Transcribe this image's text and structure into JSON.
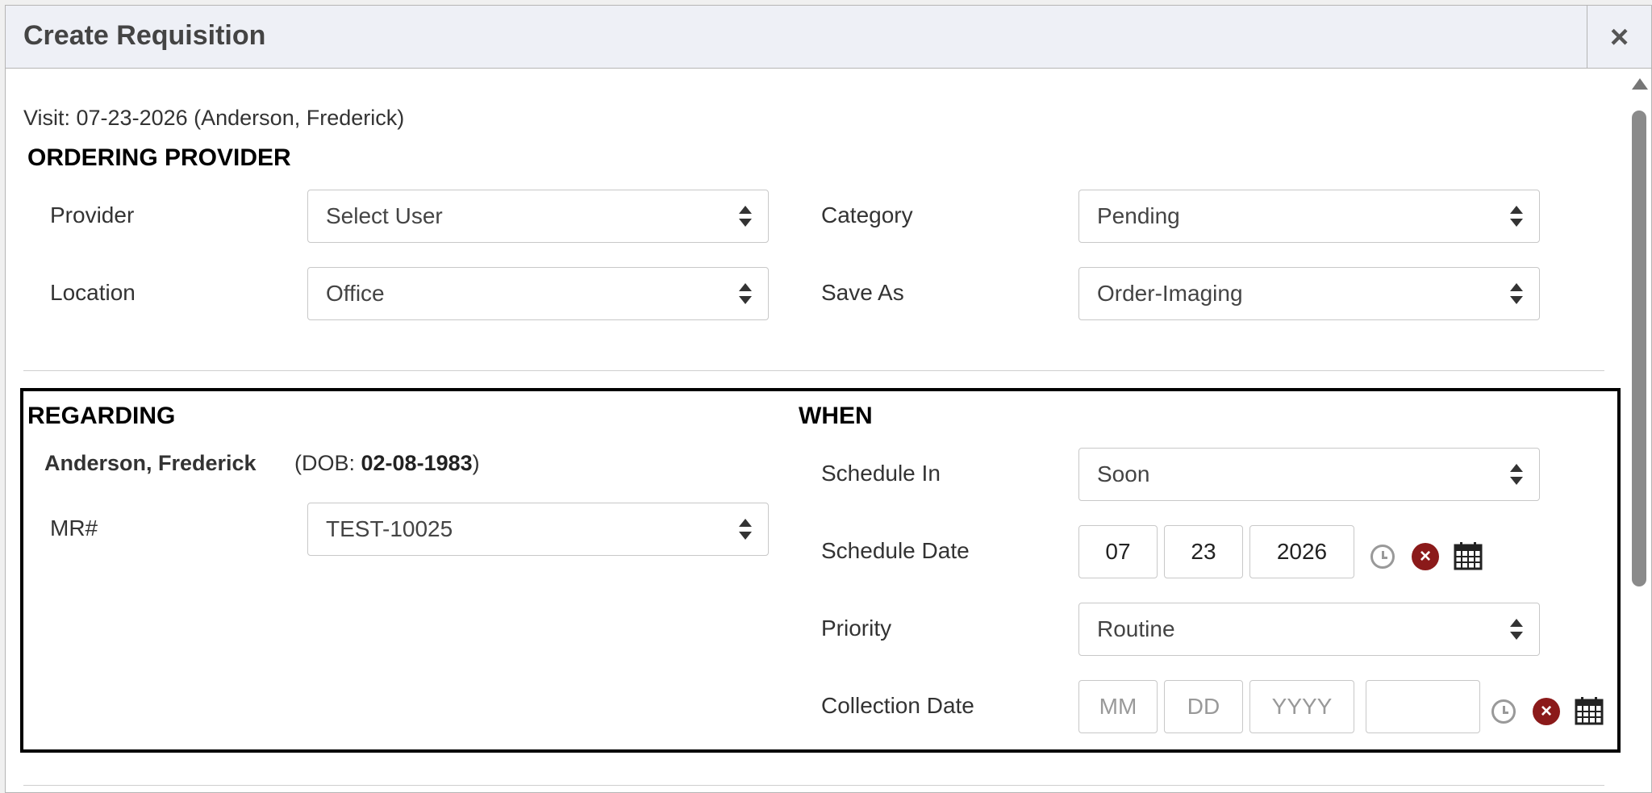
{
  "dialog": {
    "title": "Create Requisition",
    "close_label": "×"
  },
  "visit_text": "Visit: 07-23-2026 (Anderson, Frederick)",
  "ordering_provider": {
    "heading": "ORDERING PROVIDER",
    "provider": {
      "label": "Provider",
      "value": "Select User"
    },
    "category": {
      "label": "Category",
      "value": "Pending"
    },
    "location": {
      "label": "Location",
      "value": "Office"
    },
    "save_as": {
      "label": "Save As",
      "value": "Order-Imaging"
    }
  },
  "regarding": {
    "heading": "REGARDING",
    "patient_name": "Anderson, Frederick",
    "dob_prefix": "(DOB: ",
    "dob_value": "02-08-1983",
    "dob_suffix": ")",
    "mr": {
      "label": "MR#",
      "value": "TEST-10025"
    }
  },
  "when": {
    "heading": "WHEN",
    "schedule_in": {
      "label": "Schedule In",
      "value": "Soon"
    },
    "schedule_date": {
      "label": "Schedule Date",
      "month": "07",
      "day": "23",
      "year": "2026"
    },
    "priority": {
      "label": "Priority",
      "value": "Routine"
    },
    "collection_date": {
      "label": "Collection Date",
      "month_placeholder": "MM",
      "day_placeholder": "DD",
      "year_placeholder": "YYYY",
      "time_value": ""
    }
  },
  "icons": {
    "clock": "clock-icon",
    "clear": "clear-icon",
    "calendar": "calendar-icon"
  },
  "colors": {
    "clear_icon": "#8b1a1a",
    "header_bg": "#eef0f6",
    "highlight_border": "#000000"
  }
}
